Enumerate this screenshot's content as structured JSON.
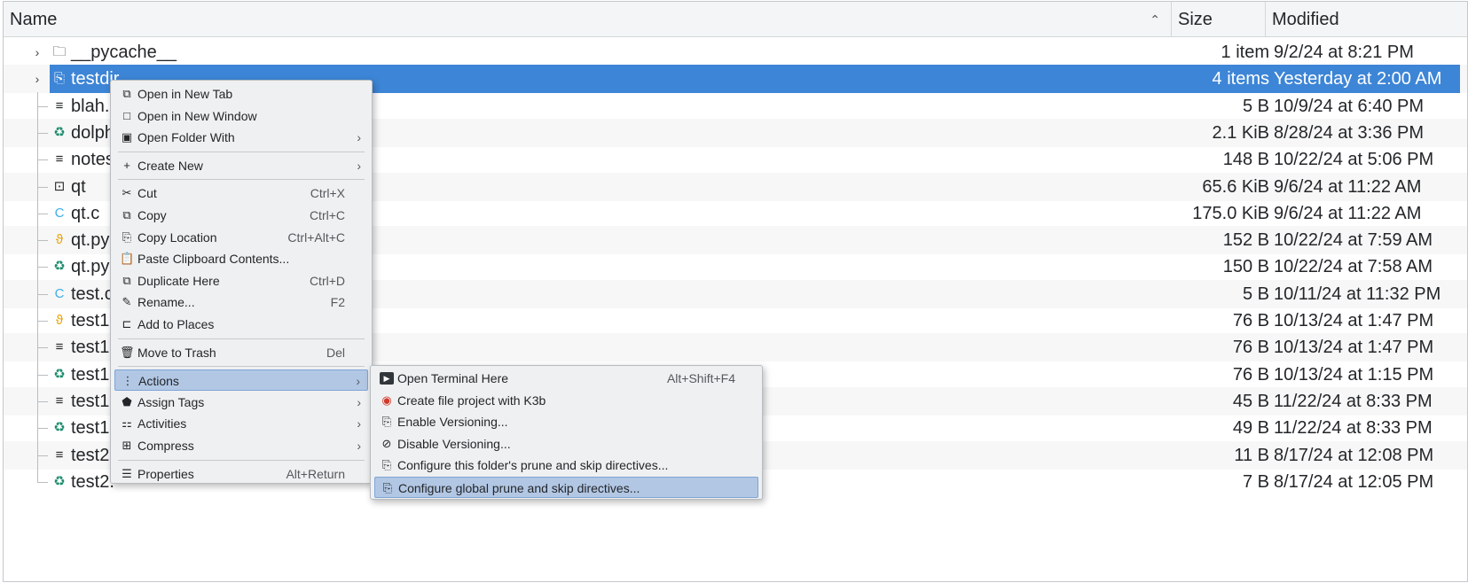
{
  "header": {
    "name": "Name",
    "size": "Size",
    "modified": "Modified",
    "sort_arrow": "^"
  },
  "files": [
    {
      "name": "__pycache__",
      "size": "1 item",
      "modified": "9/2/24 at 8:21 PM",
      "icon": "folder-icon",
      "glyph": "🗀",
      "expandable": true,
      "selected": false
    },
    {
      "name": "testdir",
      "size": "4 items",
      "modified": "Yesterday at 2:00 AM",
      "icon": "folder-link-icon",
      "glyph": "⎘",
      "expandable": true,
      "selected": true
    },
    {
      "name": "blah.b",
      "size": "5 B",
      "modified": "10/9/24 at 6:40 PM",
      "icon": "text-file-icon",
      "glyph": "≡",
      "expandable": false,
      "selected": false
    },
    {
      "name": "dolph",
      "size": "2.1 KiB",
      "modified": "8/28/24 at 3:36 PM",
      "icon": "recycle-icon",
      "glyph": "♻",
      "expandable": false,
      "selected": false
    },
    {
      "name": "notes",
      "size": "148 B",
      "modified": "10/22/24 at 5:06 PM",
      "icon": "text-file-icon",
      "glyph": "≡",
      "expandable": false,
      "selected": false
    },
    {
      "name": "qt",
      "size": "65.6 KiB",
      "modified": "9/6/24 at 11:22 AM",
      "icon": "executable-icon",
      "glyph": "⊡",
      "expandable": false,
      "selected": false
    },
    {
      "name": "qt.c",
      "size": "175.0 KiB",
      "modified": "9/6/24 at 11:22 AM",
      "icon": "c-source-icon",
      "glyph": "C",
      "expandable": false,
      "selected": false
    },
    {
      "name": "qt.py",
      "size": "152 B",
      "modified": "10/22/24 at 7:59 AM",
      "icon": "python-icon",
      "glyph": "ϑ",
      "expandable": false,
      "selected": false
    },
    {
      "name": "qt.py-",
      "size": "150 B",
      "modified": "10/22/24 at 7:58 AM",
      "icon": "recycle-icon",
      "glyph": "♻",
      "expandable": false,
      "selected": false
    },
    {
      "name": "test.c",
      "size": "5 B",
      "modified": "10/11/24 at 11:32 PM",
      "icon": "c-source-icon",
      "glyph": "C",
      "expandable": false,
      "selected": false
    },
    {
      "name": "test1.",
      "size": "76 B",
      "modified": "10/13/24 at 1:47 PM",
      "icon": "python-icon",
      "glyph": "ϑ",
      "expandable": false,
      "selected": false
    },
    {
      "name": "test1.",
      "size": "76 B",
      "modified": "10/13/24 at 1:47 PM",
      "icon": "text-file-icon",
      "glyph": "≡",
      "expandable": false,
      "selected": false
    },
    {
      "name": "test1.",
      "size": "76 B",
      "modified": "10/13/24 at 1:15 PM",
      "icon": "recycle-icon",
      "glyph": "♻",
      "expandable": false,
      "selected": false
    },
    {
      "name": "test1.",
      "size": "45 B",
      "modified": "11/22/24 at 8:33 PM",
      "icon": "text-file-icon",
      "glyph": "≡",
      "expandable": false,
      "selected": false
    },
    {
      "name": "test1.",
      "size": "49 B",
      "modified": "11/22/24 at 8:33 PM",
      "icon": "recycle-icon",
      "glyph": "♻",
      "expandable": false,
      "selected": false
    },
    {
      "name": "test2.",
      "size": "11 B",
      "modified": "8/17/24 at 12:08 PM",
      "icon": "text-file-icon",
      "glyph": "≡",
      "expandable": false,
      "selected": false
    },
    {
      "name": "test2.",
      "size": "7 B",
      "modified": "8/17/24 at 12:05 PM",
      "icon": "recycle-icon",
      "glyph": "♻",
      "expandable": false,
      "selected": false
    }
  ],
  "context_menu": {
    "items": [
      {
        "label": "Open in New Tab",
        "shortcut": "",
        "icon": "new-tab-icon",
        "glyph": "⧉",
        "submenu": false,
        "highlighted": false
      },
      {
        "label": "Open in New Window",
        "shortcut": "",
        "icon": "new-window-icon",
        "glyph": "□",
        "submenu": false,
        "highlighted": false
      },
      {
        "label": "Open Folder With",
        "shortcut": "",
        "icon": "open-with-icon",
        "glyph": "▣",
        "submenu": true,
        "highlighted": false
      },
      {
        "separator": true
      },
      {
        "label": "Create New",
        "shortcut": "",
        "icon": "plus-icon",
        "glyph": "+",
        "submenu": true,
        "highlighted": false
      },
      {
        "separator": true
      },
      {
        "label": "Cut",
        "shortcut": "Ctrl+X",
        "icon": "scissors-icon",
        "glyph": "✂",
        "submenu": false,
        "highlighted": false
      },
      {
        "label": "Copy",
        "shortcut": "Ctrl+C",
        "icon": "copy-icon",
        "glyph": "⧉",
        "submenu": false,
        "highlighted": false
      },
      {
        "label": "Copy Location",
        "shortcut": "Ctrl+Alt+C",
        "icon": "copy-location-icon",
        "glyph": "⎘",
        "submenu": false,
        "highlighted": false
      },
      {
        "label": "Paste Clipboard Contents...",
        "shortcut": "",
        "icon": "paste-icon",
        "glyph": "📋",
        "submenu": false,
        "highlighted": false
      },
      {
        "label": "Duplicate Here",
        "shortcut": "Ctrl+D",
        "icon": "duplicate-icon",
        "glyph": "⧉",
        "submenu": false,
        "highlighted": false
      },
      {
        "label": "Rename...",
        "shortcut": "F2",
        "icon": "pencil-icon",
        "glyph": "✎",
        "submenu": false,
        "highlighted": false
      },
      {
        "label": "Add to Places",
        "shortcut": "",
        "icon": "bookmark-icon",
        "glyph": "⊏",
        "submenu": false,
        "highlighted": false
      },
      {
        "separator": true
      },
      {
        "label": "Move to Trash",
        "shortcut": "Del",
        "icon": "trash-icon",
        "glyph": "🗑",
        "submenu": false,
        "highlighted": false
      },
      {
        "separator": true
      },
      {
        "label": "Actions",
        "shortcut": "",
        "icon": "more-vertical-icon",
        "glyph": "⋮",
        "submenu": true,
        "highlighted": true
      },
      {
        "label": "Assign Tags",
        "shortcut": "",
        "icon": "tag-icon",
        "glyph": "⬟",
        "submenu": true,
        "highlighted": false
      },
      {
        "label": "Activities",
        "shortcut": "",
        "icon": "activities-icon",
        "glyph": "⚏",
        "submenu": true,
        "highlighted": false
      },
      {
        "label": "Compress",
        "shortcut": "",
        "icon": "archive-icon",
        "glyph": "⊞",
        "submenu": true,
        "highlighted": false
      },
      {
        "separator": true
      },
      {
        "label": "Properties",
        "shortcut": "Alt+Return",
        "icon": "properties-icon",
        "glyph": "☰",
        "submenu": false,
        "highlighted": false
      }
    ]
  },
  "actions_menu": {
    "items": [
      {
        "label": "Open Terminal Here",
        "shortcut": "Alt+Shift+F4",
        "icon": "terminal-icon",
        "glyph": "▶",
        "highlighted": false
      },
      {
        "label": "Create file project with K3b",
        "shortcut": "",
        "icon": "k3b-icon",
        "glyph": "◉",
        "highlighted": false
      },
      {
        "label": "Enable Versioning...",
        "shortcut": "",
        "icon": "document-icon",
        "glyph": "⎘",
        "highlighted": false
      },
      {
        "label": "Disable Versioning...",
        "shortcut": "",
        "icon": "cancel-icon",
        "glyph": "⊘",
        "highlighted": false
      },
      {
        "label": "Configure this folder's prune and skip directives...",
        "shortcut": "",
        "icon": "document-icon",
        "glyph": "⎘",
        "highlighted": false
      },
      {
        "label": "Configure global prune and skip directives...",
        "shortcut": "",
        "icon": "document-icon",
        "glyph": "⎘",
        "highlighted": true
      }
    ]
  },
  "colors": {
    "selection": "#3d85d6",
    "menu_highlight": "#b2c7e4",
    "recycle_icon": "#1c8c6c",
    "python_icon": "#e8a100",
    "c_icon": "#3daee9",
    "k3b_icon": "#d03a2a"
  }
}
